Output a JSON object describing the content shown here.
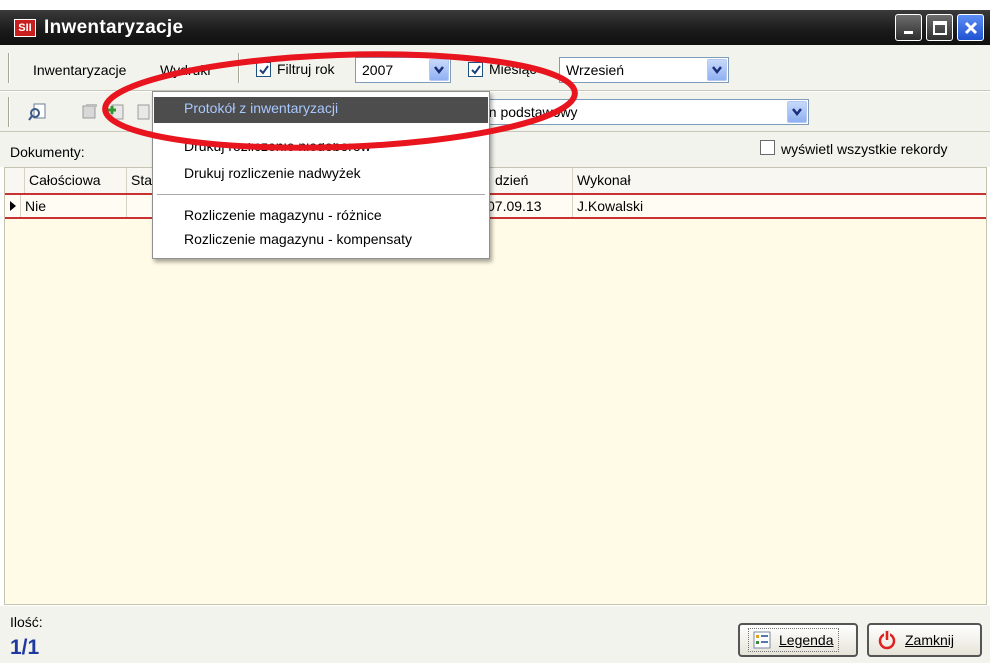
{
  "window": {
    "title": "Inwentaryzacje",
    "logo_text": "SII"
  },
  "menubar": {
    "inwentaryzacje": "Inwentaryzacje",
    "wydruki": "Wydruki",
    "filtruj_rok_label": "Filtruj rok",
    "filtruj_rok_checked": true,
    "rok_value": "2007",
    "miesiac_label": "Miesiąc",
    "miesiac_checked": true,
    "miesiac_value": "Wrzesień"
  },
  "toolbar": {
    "magazyn_value": "Magazyn podstawowy",
    "magazyn_visible_text": "azyn podstawowy"
  },
  "filter": {
    "dokumenty_label": "Dokumenty:",
    "show_all_label": "wyświetl wszystkie rekordy",
    "show_all_checked": false
  },
  "dropdown": {
    "items": [
      "Protokół z inwentaryzacji",
      "Drukuj rozliczenie niedoborów",
      "Drukuj rozliczenie nadwyżek",
      "Rozliczenie magazynu - różnice",
      "Rozliczenie magazynu - kompensaty"
    ],
    "highlighted_index": 0
  },
  "grid": {
    "columns": [
      "Całościowa",
      "Sta",
      "dzień",
      "Wykonał"
    ],
    "rows": [
      {
        "calosciowa": "Nie",
        "status": "",
        "dzien": "07.09.13",
        "wykonal": "J.Kowalski"
      }
    ]
  },
  "footer": {
    "count_label": "Ilość:",
    "count_value": "1/1",
    "legenda_button": "Legenda",
    "zamknij_button": "Zamknij"
  },
  "colors": {
    "grid_background": "#fffbe6",
    "annotation_red": "#e8141e",
    "menu_highlight": "#4d4d4d"
  }
}
